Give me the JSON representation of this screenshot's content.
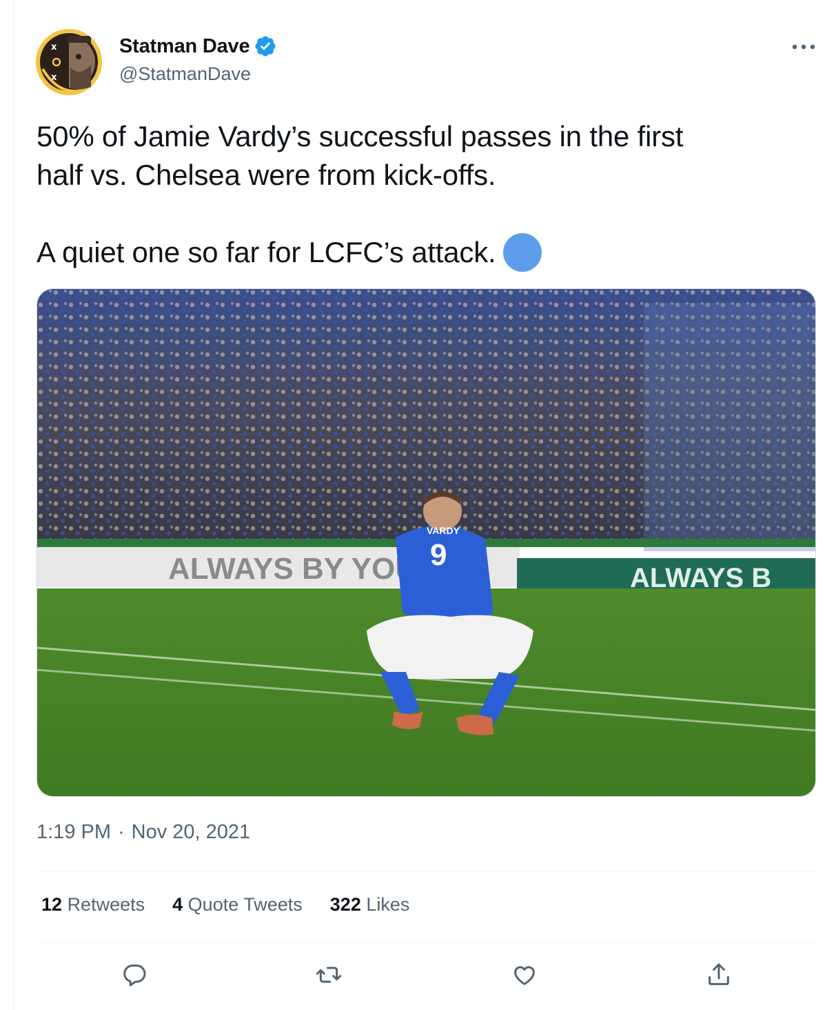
{
  "author": {
    "display_name": "Statman Dave",
    "handle": "@StatmanDave",
    "verified": true,
    "avatar_icon": "tic-tac-toe-face-icon"
  },
  "tweet": {
    "lines": [
      "50% of Jamie Vardy’s successful passes in the first\nhalf vs. Chelsea were from kick-offs.",
      "A quiet one so far for LCFC’s attack."
    ],
    "emoji": "blue-circle",
    "media": {
      "shirt_name": "VARDY",
      "shirt_number": "9",
      "ad_board_left": "ALWAYS BY YOU",
      "ad_board_right": "ALWAYS B"
    }
  },
  "meta": {
    "time": "1:19 PM",
    "separator": "·",
    "date": "Nov 20, 2021"
  },
  "stats": {
    "retweets_count": "12",
    "retweets_label": "Retweets",
    "quotes_count": "4",
    "quotes_label": "Quote Tweets",
    "likes_count": "322",
    "likes_label": "Likes"
  },
  "actions": [
    "reply-icon",
    "retweet-icon",
    "like-icon",
    "share-icon"
  ],
  "colors": {
    "text": "#0f1419",
    "secondary": "#536471",
    "verified": "#1d9bf0",
    "divider": "#eff3f4",
    "emoji_blue": "#5d9eea"
  }
}
